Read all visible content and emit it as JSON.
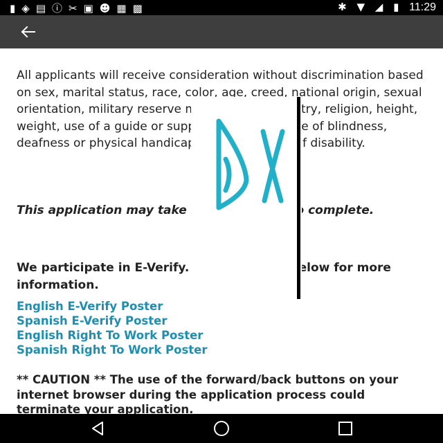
{
  "status_bar": {
    "left_icons": [
      "notification-icon",
      "eye-icon",
      "email-icon",
      "info-icon",
      "no-signal-icon",
      "lock-icon",
      "cat-icon",
      "photo-icon",
      "briefcase-icon"
    ],
    "right_icons": [
      "bluetooth-icon",
      "wifi-icon",
      "cellular-icon",
      "battery-icon"
    ],
    "time": "11:29"
  },
  "app_bar": {
    "back_icon": "arrow-left-icon"
  },
  "content": {
    "intro": "All applicants will receive consideration without discrimination based on sex, marital status, race, color, age, creed, national origin, sexual orientation, military reserve membership, ancestry, religion, height, weight, use of a guide or support animal because of blindness, deafness or physical handicap or the presence of disability.",
    "time_notice": "This application may take 20-30 minutes to complete.",
    "everify_notice": "We participate in E-Verify. Click the links below for more information.",
    "links": [
      "English E-Verify Poster",
      "Spanish E-Verify Poster",
      "English Right To Work Poster",
      "Spanish Right To Work Poster"
    ],
    "caution": "** CAUTION ** The use of the forward/back buttons on your internet browser during the application process could terminate your application."
  },
  "overlay": {
    "logo_letters": "DX",
    "logo_color": "#22b0c8"
  },
  "nav_bar": {
    "back": "triangle-back-icon",
    "home": "circle-home-icon",
    "recents": "square-recents-icon"
  },
  "colors": {
    "link": "#1e8fb1",
    "app_bar": "#3e3e3e",
    "status_bar": "#000000"
  }
}
